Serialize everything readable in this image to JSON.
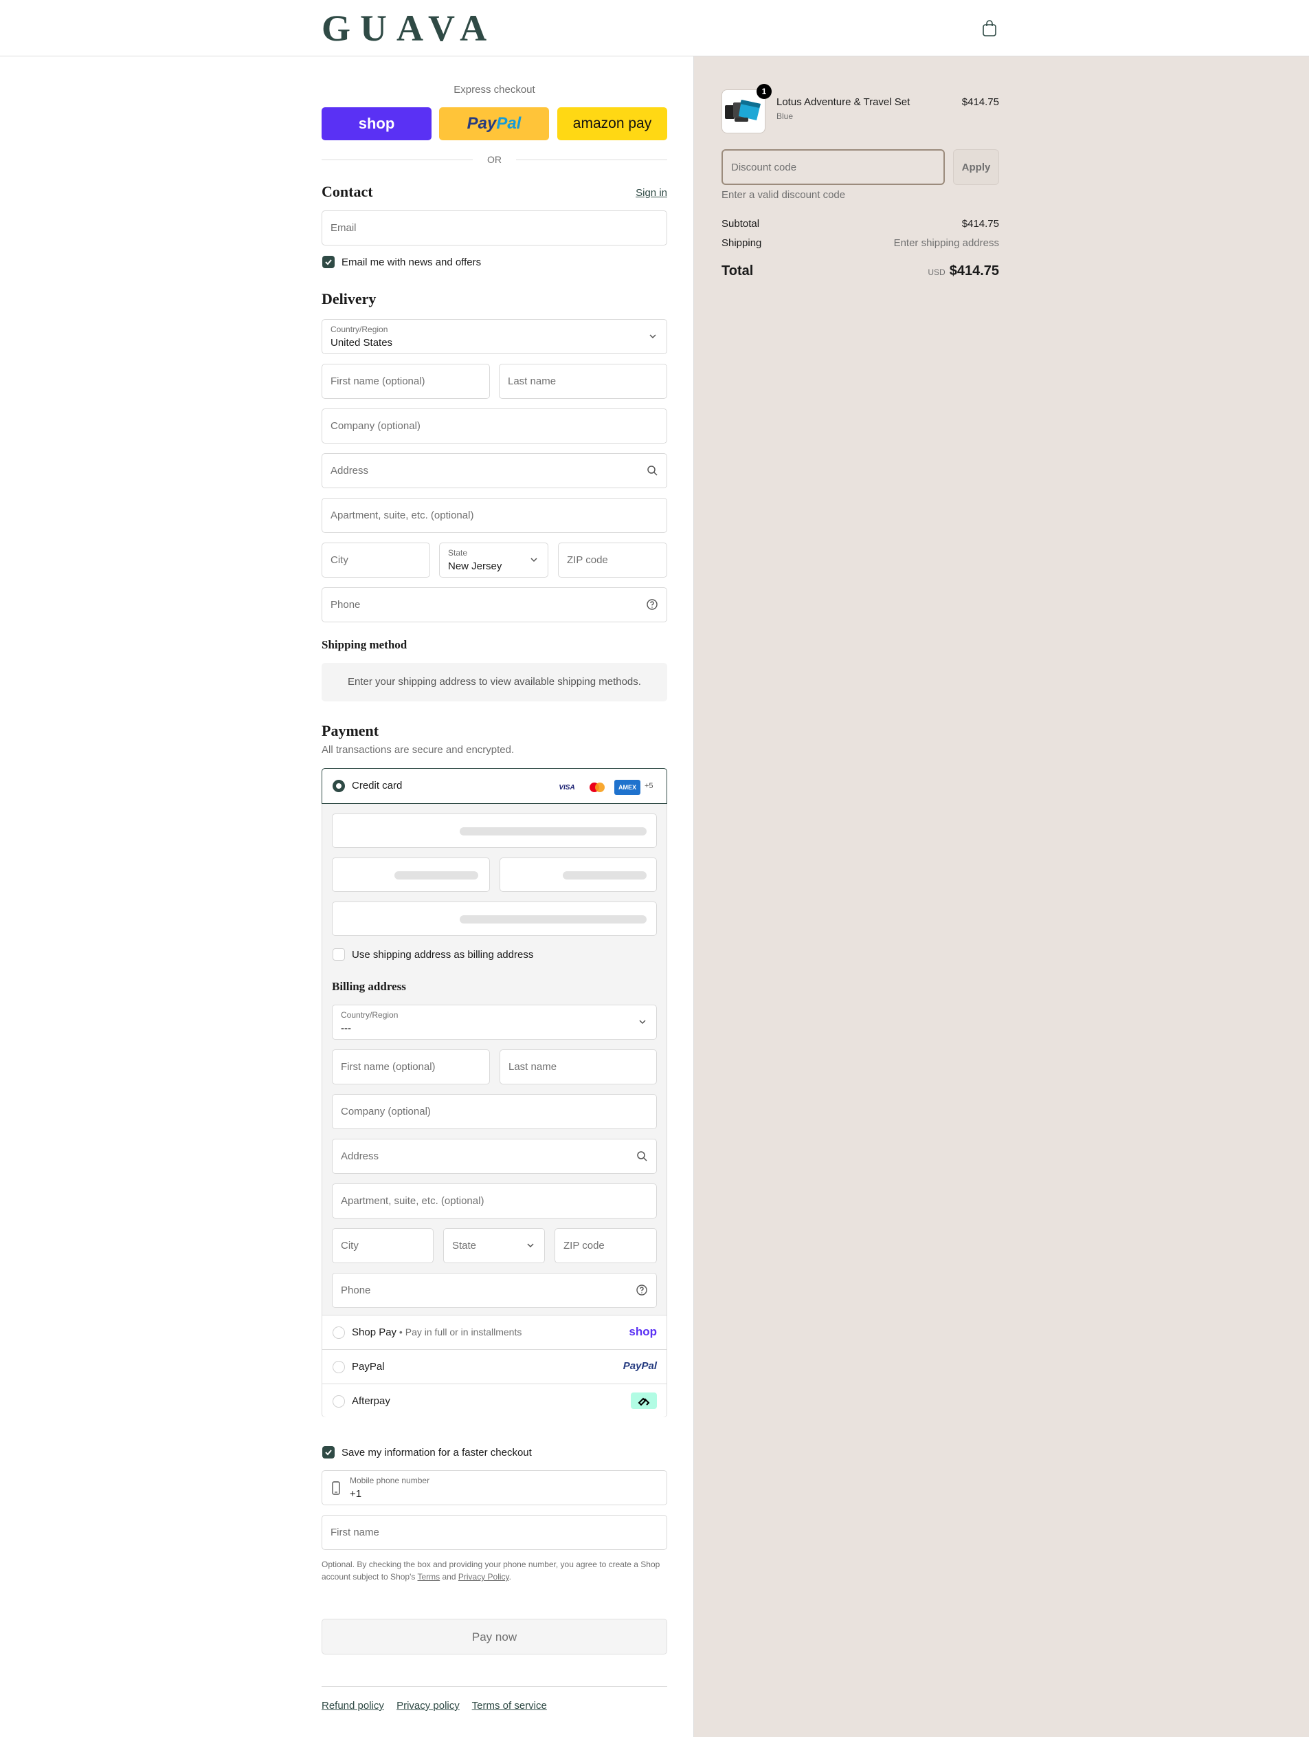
{
  "header": {
    "logo": "GUAVA",
    "cart_icon": "bag-icon"
  },
  "express": {
    "title": "Express checkout",
    "shop_label": "shop",
    "paypal_label_1": "Pay",
    "paypal_label_2": "Pal",
    "amazon_label": "amazon pay",
    "or_label": "OR"
  },
  "contact": {
    "heading": "Contact",
    "sign_in": "Sign in",
    "email_placeholder": "Email",
    "newsletter_label": "Email me with news and offers",
    "newsletter_checked": true
  },
  "delivery": {
    "heading": "Delivery",
    "country_label": "Country/Region",
    "country_value": "United States",
    "first_name_placeholder": "First name (optional)",
    "last_name_placeholder": "Last name",
    "company_placeholder": "Company (optional)",
    "address_placeholder": "Address",
    "apartment_placeholder": "Apartment, suite, etc. (optional)",
    "city_placeholder": "City",
    "state_label": "State",
    "state_value": "New Jersey",
    "zip_placeholder": "ZIP code",
    "phone_placeholder": "Phone"
  },
  "shipping": {
    "heading": "Shipping method",
    "notice": "Enter your shipping address to view available shipping methods."
  },
  "payment": {
    "heading": "Payment",
    "subtitle": "All transactions are secure and encrypted.",
    "credit_card_label": "Credit card",
    "card_logos": [
      "VISA",
      "mastercard",
      "AMEX"
    ],
    "more_cards": "+5",
    "billing_same_label": "Use shipping address as billing address",
    "billing_heading": "Billing address",
    "billing": {
      "country_label": "Country/Region",
      "country_value": "---",
      "first_name_placeholder": "First name (optional)",
      "last_name_placeholder": "Last name",
      "company_placeholder": "Company (optional)",
      "address_placeholder": "Address",
      "apartment_placeholder": "Apartment, suite, etc. (optional)",
      "city_placeholder": "City",
      "state_placeholder": "State",
      "zip_placeholder": "ZIP code",
      "phone_placeholder": "Phone"
    },
    "methods": [
      {
        "name": "Shop Pay",
        "sub": "Pay in full or in installments",
        "logo": "shop"
      },
      {
        "name": "PayPal",
        "sub": "",
        "logo": "PayPal"
      },
      {
        "name": "Afterpay",
        "sub": "",
        "logo": "afterpay"
      }
    ]
  },
  "remember": {
    "label": "Save my information for a faster checkout",
    "checked": true,
    "mobile_label": "Mobile phone number",
    "mobile_value": "+1",
    "first_name_placeholder": "First name",
    "disclaimer_1": "Optional. By checking the box and providing your phone number, you agree to create a Shop account subject to Shop's ",
    "terms": "Terms",
    "and": " and ",
    "privacy": "Privacy Policy",
    "period": "."
  },
  "pay_now": "Pay now",
  "footer": {
    "refund": "Refund policy",
    "privacy": "Privacy policy",
    "terms": "Terms of service"
  },
  "summary": {
    "item": {
      "name": "Lotus Adventure & Travel Set",
      "variant": "Blue",
      "price": "$414.75",
      "quantity": "1"
    },
    "discount_placeholder": "Discount code",
    "apply_label": "Apply",
    "discount_error": "Enter a valid discount code",
    "subtotal_label": "Subtotal",
    "subtotal_value": "$414.75",
    "shipping_label": "Shipping",
    "shipping_value": "Enter shipping address",
    "total_label": "Total",
    "currency": "USD",
    "total_value": "$414.75"
  },
  "colors": {
    "accent": "#2f4a45",
    "summary_bg": "#e9e2dd",
    "shop_purple": "#5a31f4"
  }
}
